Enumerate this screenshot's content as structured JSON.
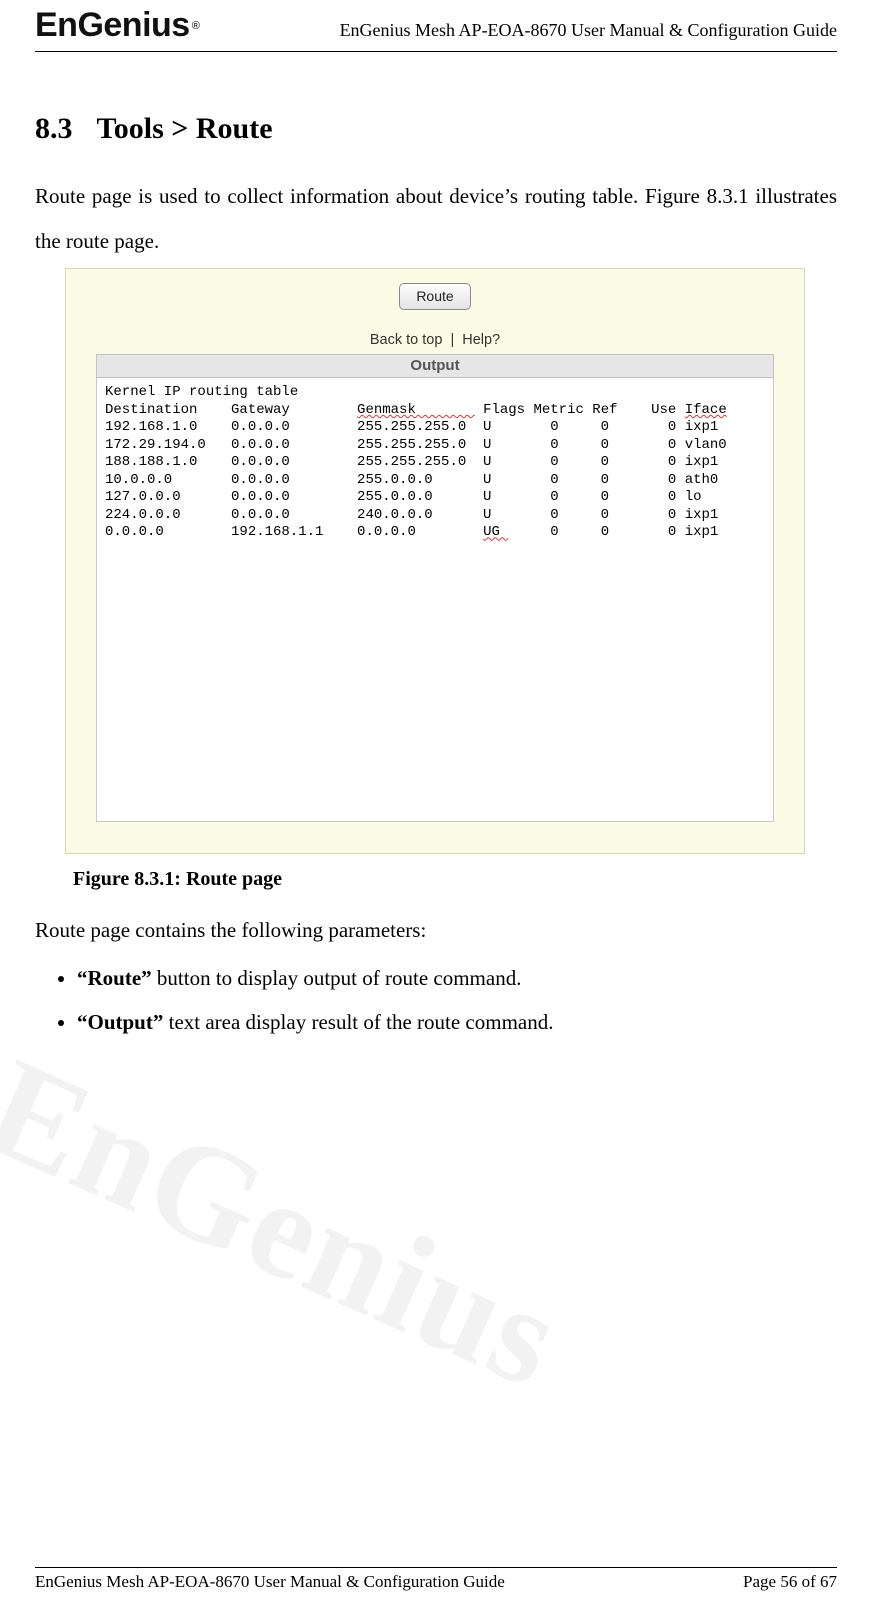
{
  "header": {
    "logo_text_1": "En",
    "logo_text_2": "Gen",
    "logo_text_3": "ius",
    "logo_reg": "®",
    "doc_title": "EnGenius Mesh AP-EOA-8670 User Manual & Configuration Guide"
  },
  "section": {
    "number": "8.3",
    "title": "Tools > Route"
  },
  "intro_para": "Route page is used to collect information about device’s routing table. Figure 8.3.1 illustrates the route page.",
  "figure": {
    "route_button_label": "Route",
    "link_back": "Back to top",
    "link_sep": "|",
    "link_help": "Help?",
    "output_label": "Output",
    "table_title": "Kernel IP routing table",
    "columns": {
      "dest": "Destination",
      "gw": "Gateway",
      "mask": "Genmask",
      "flags": "Flags",
      "metric": "Metric",
      "ref": "Ref",
      "use": "Use",
      "iface": "Iface"
    },
    "rows": [
      {
        "dest": "192.168.1.0",
        "gw": "0.0.0.0",
        "mask": "255.255.255.0",
        "flags": "U",
        "metric": "0",
        "ref": "0",
        "use": "0",
        "iface": "ixp1"
      },
      {
        "dest": "172.29.194.0",
        "gw": "0.0.0.0",
        "mask": "255.255.255.0",
        "flags": "U",
        "metric": "0",
        "ref": "0",
        "use": "0",
        "iface": "vlan0"
      },
      {
        "dest": "188.188.1.0",
        "gw": "0.0.0.0",
        "mask": "255.255.255.0",
        "flags": "U",
        "metric": "0",
        "ref": "0",
        "use": "0",
        "iface": "ixp1"
      },
      {
        "dest": "10.0.0.0",
        "gw": "0.0.0.0",
        "mask": "255.0.0.0",
        "flags": "U",
        "metric": "0",
        "ref": "0",
        "use": "0",
        "iface": "ath0"
      },
      {
        "dest": "127.0.0.0",
        "gw": "0.0.0.0",
        "mask": "255.0.0.0",
        "flags": "U",
        "metric": "0",
        "ref": "0",
        "use": "0",
        "iface": "lo"
      },
      {
        "dest": "224.0.0.0",
        "gw": "0.0.0.0",
        "mask": "240.0.0.0",
        "flags": "U",
        "metric": "0",
        "ref": "0",
        "use": "0",
        "iface": "ixp1"
      },
      {
        "dest": "0.0.0.0",
        "gw": "192.168.1.1",
        "mask": "0.0.0.0",
        "flags": "UG",
        "metric": "0",
        "ref": "0",
        "use": "0",
        "iface": "ixp1"
      }
    ]
  },
  "caption": "Figure 8.3.1: Route page",
  "params_intro": "Route page contains the following parameters:",
  "params": [
    {
      "bold": "“Route”",
      "rest": " button to display output of route command."
    },
    {
      "bold": "“Output”",
      "rest": " text area display result of the route command."
    }
  ],
  "watermark": "EnGenius",
  "footer": {
    "left": "EnGenius Mesh AP-EOA-8670 User Manual & Configuration Guide",
    "right": "Page 56 of 67"
  }
}
